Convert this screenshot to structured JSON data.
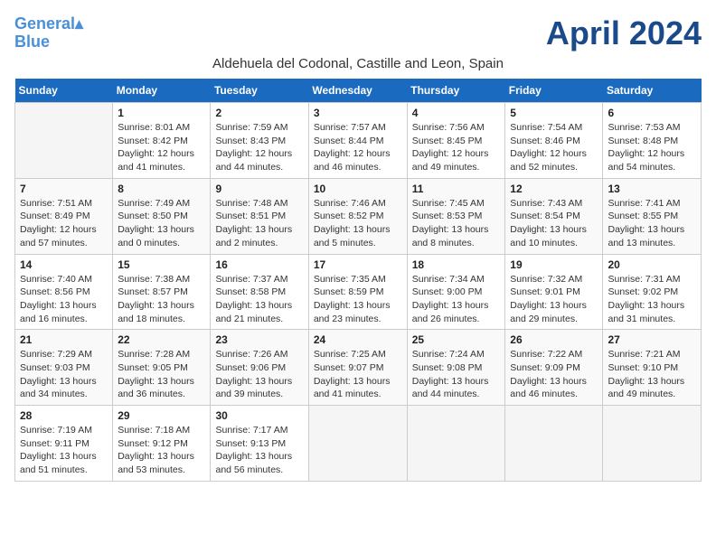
{
  "logo": {
    "line1": "General",
    "line2": "Blue"
  },
  "title": "April 2024",
  "subtitle": "Aldehuela del Codonal, Castille and Leon, Spain",
  "headers": [
    "Sunday",
    "Monday",
    "Tuesday",
    "Wednesday",
    "Thursday",
    "Friday",
    "Saturday"
  ],
  "weeks": [
    [
      {
        "day": "",
        "info": ""
      },
      {
        "day": "1",
        "info": "Sunrise: 8:01 AM\nSunset: 8:42 PM\nDaylight: 12 hours\nand 41 minutes."
      },
      {
        "day": "2",
        "info": "Sunrise: 7:59 AM\nSunset: 8:43 PM\nDaylight: 12 hours\nand 44 minutes."
      },
      {
        "day": "3",
        "info": "Sunrise: 7:57 AM\nSunset: 8:44 PM\nDaylight: 12 hours\nand 46 minutes."
      },
      {
        "day": "4",
        "info": "Sunrise: 7:56 AM\nSunset: 8:45 PM\nDaylight: 12 hours\nand 49 minutes."
      },
      {
        "day": "5",
        "info": "Sunrise: 7:54 AM\nSunset: 8:46 PM\nDaylight: 12 hours\nand 52 minutes."
      },
      {
        "day": "6",
        "info": "Sunrise: 7:53 AM\nSunset: 8:48 PM\nDaylight: 12 hours\nand 54 minutes."
      }
    ],
    [
      {
        "day": "7",
        "info": "Sunrise: 7:51 AM\nSunset: 8:49 PM\nDaylight: 12 hours\nand 57 minutes."
      },
      {
        "day": "8",
        "info": "Sunrise: 7:49 AM\nSunset: 8:50 PM\nDaylight: 13 hours\nand 0 minutes."
      },
      {
        "day": "9",
        "info": "Sunrise: 7:48 AM\nSunset: 8:51 PM\nDaylight: 13 hours\nand 2 minutes."
      },
      {
        "day": "10",
        "info": "Sunrise: 7:46 AM\nSunset: 8:52 PM\nDaylight: 13 hours\nand 5 minutes."
      },
      {
        "day": "11",
        "info": "Sunrise: 7:45 AM\nSunset: 8:53 PM\nDaylight: 13 hours\nand 8 minutes."
      },
      {
        "day": "12",
        "info": "Sunrise: 7:43 AM\nSunset: 8:54 PM\nDaylight: 13 hours\nand 10 minutes."
      },
      {
        "day": "13",
        "info": "Sunrise: 7:41 AM\nSunset: 8:55 PM\nDaylight: 13 hours\nand 13 minutes."
      }
    ],
    [
      {
        "day": "14",
        "info": "Sunrise: 7:40 AM\nSunset: 8:56 PM\nDaylight: 13 hours\nand 16 minutes."
      },
      {
        "day": "15",
        "info": "Sunrise: 7:38 AM\nSunset: 8:57 PM\nDaylight: 13 hours\nand 18 minutes."
      },
      {
        "day": "16",
        "info": "Sunrise: 7:37 AM\nSunset: 8:58 PM\nDaylight: 13 hours\nand 21 minutes."
      },
      {
        "day": "17",
        "info": "Sunrise: 7:35 AM\nSunset: 8:59 PM\nDaylight: 13 hours\nand 23 minutes."
      },
      {
        "day": "18",
        "info": "Sunrise: 7:34 AM\nSunset: 9:00 PM\nDaylight: 13 hours\nand 26 minutes."
      },
      {
        "day": "19",
        "info": "Sunrise: 7:32 AM\nSunset: 9:01 PM\nDaylight: 13 hours\nand 29 minutes."
      },
      {
        "day": "20",
        "info": "Sunrise: 7:31 AM\nSunset: 9:02 PM\nDaylight: 13 hours\nand 31 minutes."
      }
    ],
    [
      {
        "day": "21",
        "info": "Sunrise: 7:29 AM\nSunset: 9:03 PM\nDaylight: 13 hours\nand 34 minutes."
      },
      {
        "day": "22",
        "info": "Sunrise: 7:28 AM\nSunset: 9:05 PM\nDaylight: 13 hours\nand 36 minutes."
      },
      {
        "day": "23",
        "info": "Sunrise: 7:26 AM\nSunset: 9:06 PM\nDaylight: 13 hours\nand 39 minutes."
      },
      {
        "day": "24",
        "info": "Sunrise: 7:25 AM\nSunset: 9:07 PM\nDaylight: 13 hours\nand 41 minutes."
      },
      {
        "day": "25",
        "info": "Sunrise: 7:24 AM\nSunset: 9:08 PM\nDaylight: 13 hours\nand 44 minutes."
      },
      {
        "day": "26",
        "info": "Sunrise: 7:22 AM\nSunset: 9:09 PM\nDaylight: 13 hours\nand 46 minutes."
      },
      {
        "day": "27",
        "info": "Sunrise: 7:21 AM\nSunset: 9:10 PM\nDaylight: 13 hours\nand 49 minutes."
      }
    ],
    [
      {
        "day": "28",
        "info": "Sunrise: 7:19 AM\nSunset: 9:11 PM\nDaylight: 13 hours\nand 51 minutes."
      },
      {
        "day": "29",
        "info": "Sunrise: 7:18 AM\nSunset: 9:12 PM\nDaylight: 13 hours\nand 53 minutes."
      },
      {
        "day": "30",
        "info": "Sunrise: 7:17 AM\nSunset: 9:13 PM\nDaylight: 13 hours\nand 56 minutes."
      },
      {
        "day": "",
        "info": ""
      },
      {
        "day": "",
        "info": ""
      },
      {
        "day": "",
        "info": ""
      },
      {
        "day": "",
        "info": ""
      }
    ]
  ]
}
